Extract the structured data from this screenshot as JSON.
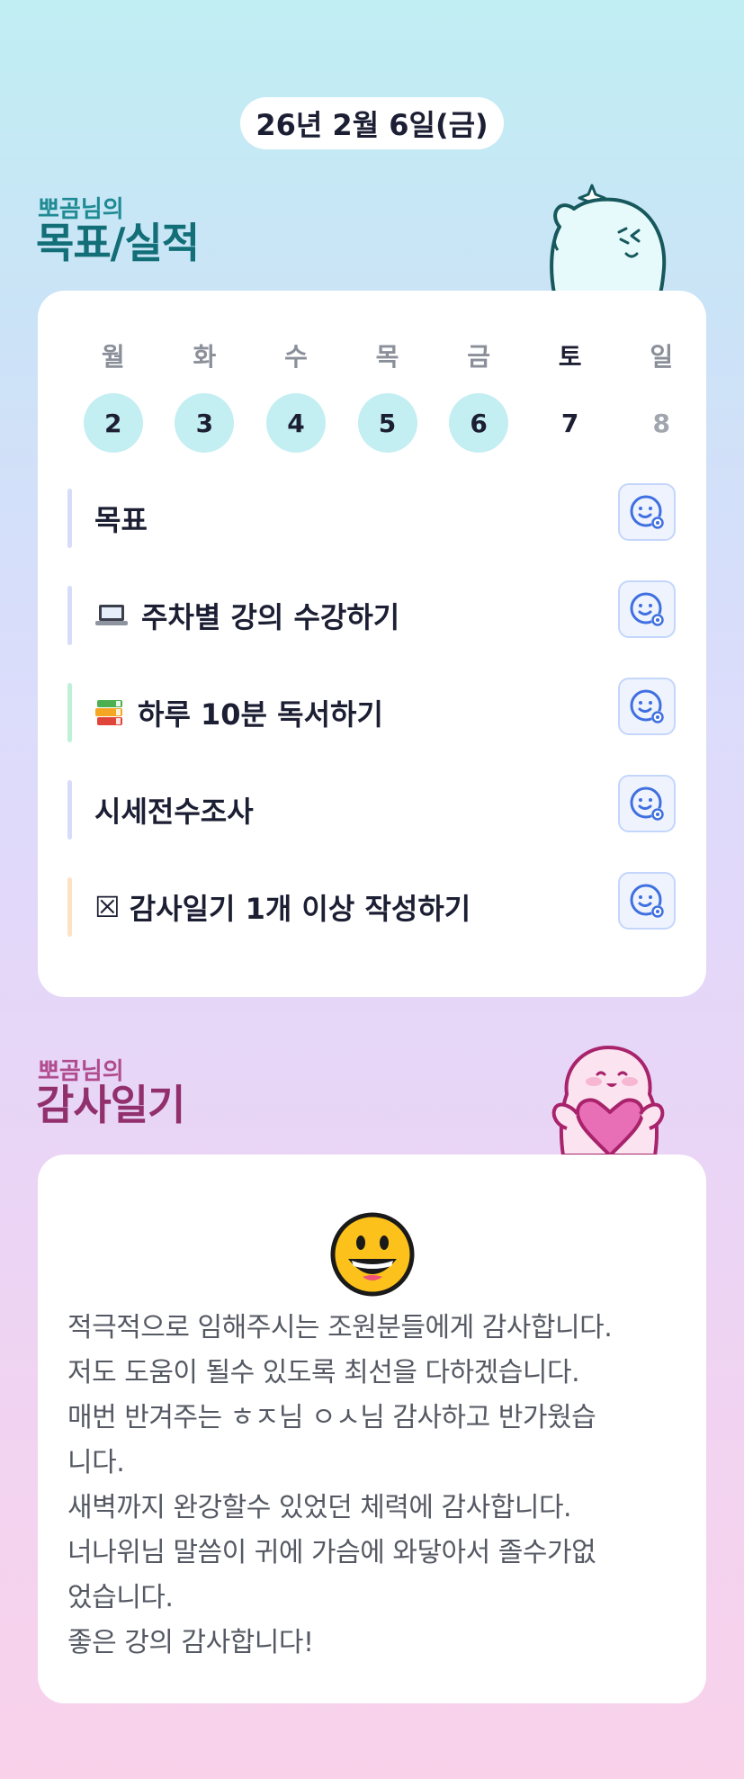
{
  "header": {
    "date": "26년 2월 6일(금)"
  },
  "goal_section": {
    "subtitle": "뽀곰님의",
    "title": "목표/실적",
    "week": {
      "days": [
        {
          "label": "월",
          "num": "2",
          "state": "done"
        },
        {
          "label": "화",
          "num": "3",
          "state": "done"
        },
        {
          "label": "수",
          "num": "4",
          "state": "done"
        },
        {
          "label": "목",
          "num": "5",
          "state": "done"
        },
        {
          "label": "금",
          "num": "6",
          "state": "done"
        },
        {
          "label": "토",
          "num": "7",
          "state": "today"
        },
        {
          "label": "일",
          "num": "8",
          "state": "future"
        }
      ]
    },
    "goals": [
      {
        "text": "목표",
        "icon": "",
        "bar_color": "#d6dcfa"
      },
      {
        "text": "주차별 강의 수강하기",
        "icon": "laptop-icon",
        "bar_color": "#d6dcfa"
      },
      {
        "text": "하루 10분 독서하기",
        "icon": "books-icon",
        "bar_color": "#bff0d8"
      },
      {
        "text": "시세전수조사",
        "icon": "",
        "bar_color": "#d6dcfa"
      },
      {
        "text": "감사일기 1개 이상 작성하기",
        "icon": "ballot-box-icon",
        "bar_color": "#fde2c4"
      }
    ],
    "ballot_glyph": "☒",
    "status_icon": "smiley-sticker-icon"
  },
  "diary_section": {
    "subtitle": "뽀곰님의",
    "title": "감사일기",
    "emoji": "grinning-face-icon",
    "lines": [
      "적극적으로 임해주시는 조원분들에게 감사합니다.",
      "저도 도움이 될수 있도록 최선을 다하겠습니다.",
      "매번 반겨주는 ㅎㅈ님 ㅇㅅ님 감사하고 반가웠습",
      "니다.",
      "새벽까지 완강할수 있었던 체력에 감사합니다.",
      "너나위님 말씀이 귀에 가슴에 와닿아서 졸수가없",
      "었습니다.",
      "좋은 강의 감사합니다!"
    ]
  },
  "colors": {
    "teal": "#1f8a93",
    "plum": "#b04b8e",
    "done_circle": "#c3eef2",
    "button_blue": "#3f6fe0"
  }
}
